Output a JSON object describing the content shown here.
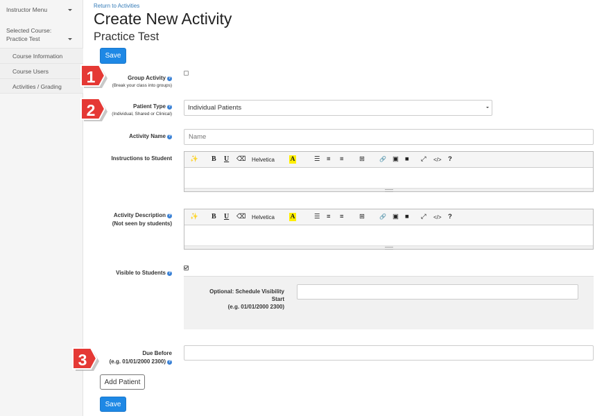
{
  "sidebar": {
    "instructor_menu": "Instructor Menu",
    "selected_course_label": "Selected Course:",
    "selected_course_name": "Practice Test",
    "items": [
      {
        "label": "Course Information"
      },
      {
        "label": "Course Users"
      },
      {
        "label": "Activities / Grading"
      }
    ]
  },
  "header": {
    "return_link": "Return to Activities",
    "title": "Create New Activity",
    "course": "Practice Test",
    "save_label": "Save"
  },
  "form": {
    "group_activity": {
      "label": "Group Activity",
      "sub": "(Break your class into groups)",
      "checked": false
    },
    "patient_type": {
      "label": "Patient Type",
      "sub": "(Individual, Shared or Clinical)",
      "value": "Individual Patients"
    },
    "activity_name": {
      "label": "Activity Name",
      "placeholder": "Name",
      "value": ""
    },
    "instructions": {
      "label": "Instructions to Student"
    },
    "description": {
      "label": "Activity Description",
      "sub": "(Not seen by students)"
    },
    "visible": {
      "label": "Visible to Students",
      "checked": true
    },
    "schedule": {
      "label_line1": "Optional: Schedule Visibility",
      "label_line2": "Start",
      "label_line3": "(e.g. 01/01/2000 2300)",
      "value": ""
    },
    "due_before": {
      "label": "Due Before",
      "sub": "(e.g. 01/01/2000 2300)",
      "value": ""
    },
    "add_patient_label": "Add Patient",
    "save_label": "Save"
  },
  "toolbar": {
    "magic": "✨",
    "bold": "B",
    "underline": "U",
    "eraser": "⌫",
    "font": "Helvetica",
    "highlight": "A",
    "ul": "☰",
    "ol": "≡",
    "align": "≡",
    "table": "⊞",
    "link": "🔗",
    "image": "▣",
    "video": "■",
    "fullscreen": "⤢",
    "code": "</>",
    "help": "?"
  },
  "callouts": [
    "1",
    "2",
    "3"
  ],
  "colors": {
    "primary": "#1e88e5",
    "callout": "#e53935",
    "help": "#3b82d6"
  }
}
